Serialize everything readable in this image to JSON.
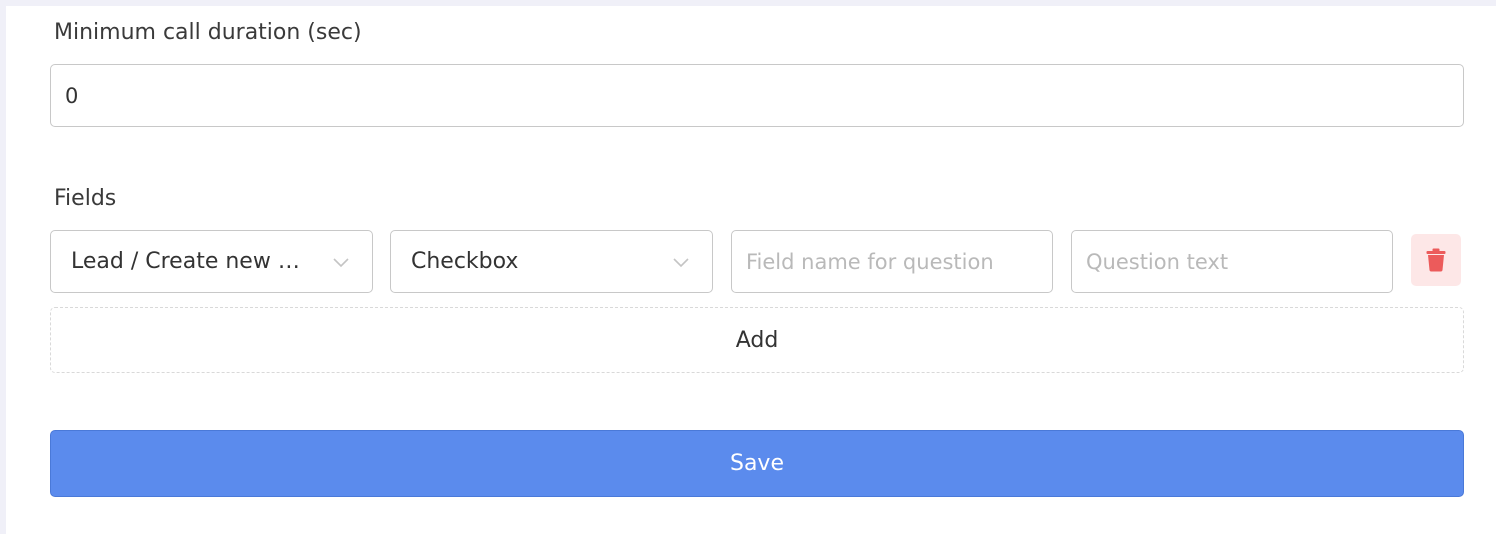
{
  "duration": {
    "label": "Minimum call duration (sec)",
    "value": "0"
  },
  "fields": {
    "label": "Fields",
    "rows": [
      {
        "target_select": "Lead / Create new fi...",
        "type_select": "Checkbox",
        "field_name_placeholder": "Field name for question",
        "question_placeholder": "Question text"
      }
    ],
    "add_label": "Add"
  },
  "save_label": "Save",
  "icons": {
    "select_arrow": "chevron-down-icon",
    "delete": "trash-icon"
  },
  "colors": {
    "primary": "#5b8bed",
    "danger": "#ec5b5b",
    "danger_bg": "#fde7e7"
  }
}
